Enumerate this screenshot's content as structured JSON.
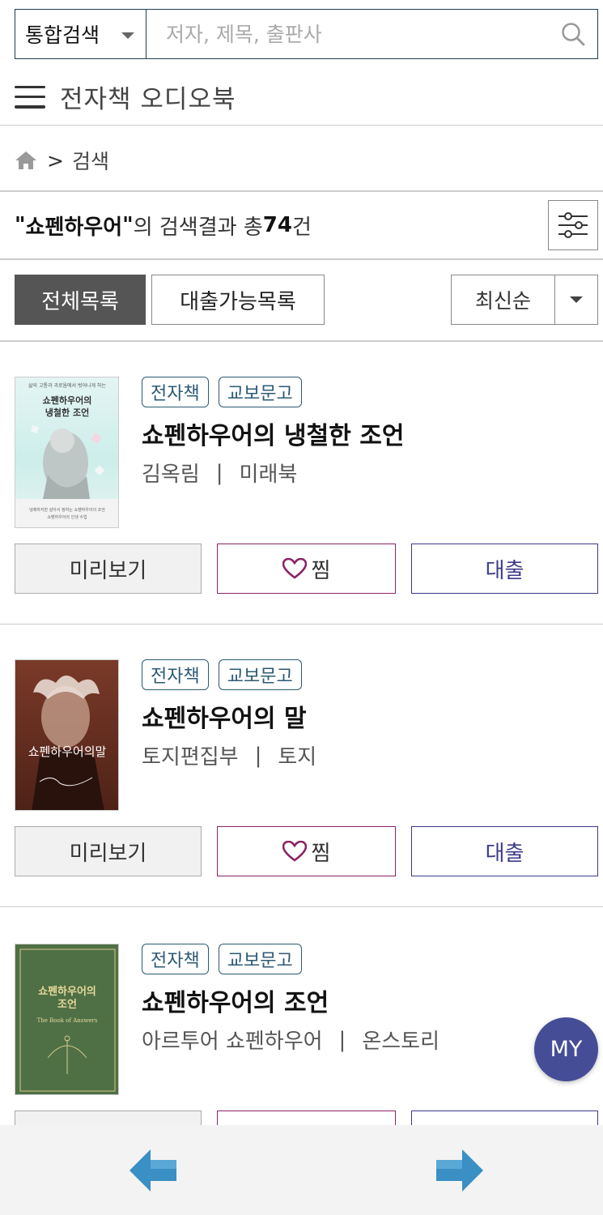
{
  "search": {
    "scope": "통합검색",
    "placeholder": "저자, 제목, 출판사"
  },
  "nav": {
    "title": "전자책 오디오북"
  },
  "breadcrumb": {
    "separator": ">",
    "current": "검색"
  },
  "result": {
    "quote_open": "\"",
    "keyword": "쇼펜하우어",
    "quote_close": "\"",
    "mid_text": "의 검색결과 총 ",
    "count": "74",
    "suffix": "건"
  },
  "tabs": {
    "all": "전체목록",
    "available": "대출가능목록"
  },
  "sort": {
    "selected": "최신순"
  },
  "books": [
    {
      "badges": [
        "전자책",
        "교보문고"
      ],
      "title": "쇼펜하우어의 냉철한 조언",
      "author": "김옥림",
      "publisher": "미래북",
      "cover_text": "쇼펜하우어의\n냉철한 조언",
      "cover_top": "삶의 고통과 괴로움에서 벗어나게 하는",
      "cover_bg": "#d9f1ef"
    },
    {
      "badges": [
        "전자책",
        "교보문고"
      ],
      "title": "쇼펜하우어의 말",
      "author": "토지편집부",
      "publisher": "토지",
      "cover_text": "쇼펜하우어의말",
      "cover_bg": "#5a2a1e"
    },
    {
      "badges": [
        "전자책",
        "교보문고"
      ],
      "title": "쇼펜하우어의 조언",
      "author": "아르투어 쇼펜하우어",
      "publisher": "온스토리",
      "cover_text": "쇼펜하우어의\n조언",
      "cover_sub": "The Book of Answers",
      "cover_bg": "#4f7045"
    }
  ],
  "buttons": {
    "preview": "미리보기",
    "wish": "찜",
    "borrow": "대출"
  },
  "fab": {
    "label": "MY"
  },
  "colors": {
    "accent_dark": "#1f3f4f",
    "badge": "#2c5a73",
    "wish": "#8a2465",
    "borrow": "#3b3a8a",
    "fab": "#454d97",
    "arrow": "#3a8fc4"
  },
  "icons": [
    "search-icon",
    "hamburger-icon",
    "home-icon",
    "filter-icon",
    "heart-icon",
    "arrow-left-icon",
    "arrow-right-icon"
  ]
}
